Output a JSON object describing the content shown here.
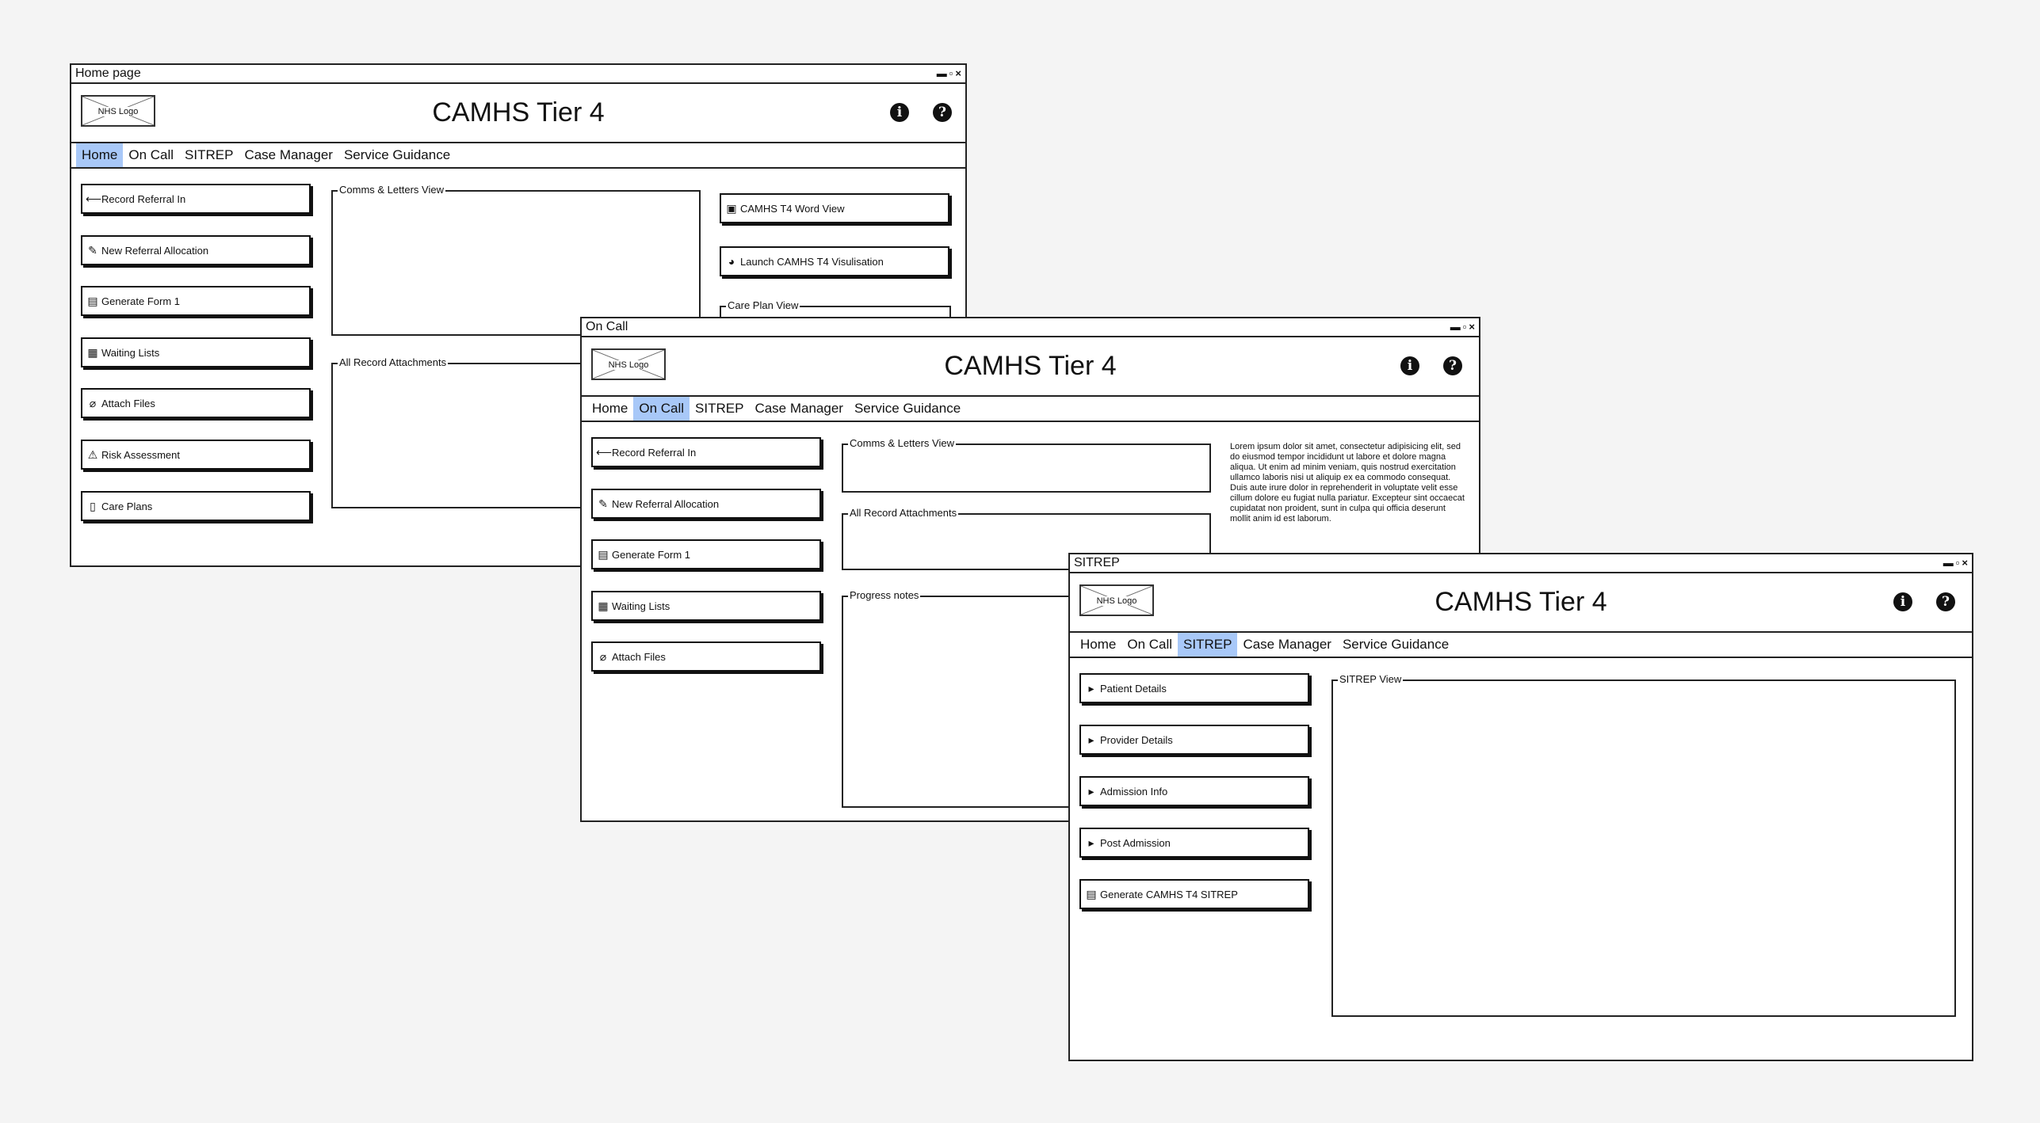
{
  "app_title": "CAMHS Tier 4",
  "logo_text": "NHS Logo",
  "window_controls": [
    "▬",
    "▫",
    "×"
  ],
  "header_icons": {
    "info": "i",
    "help": "?"
  },
  "nav": [
    "Home",
    "On Call",
    "SITREP",
    "Case Manager",
    "Service Guidance"
  ],
  "home": {
    "window_title": "Home page",
    "buttons": [
      "Record Referral In",
      "New Referral Allocation",
      "Generate Form 1",
      "Waiting Lists",
      "Attach Files",
      "Risk Assessment",
      "Care Plans"
    ],
    "panels": {
      "comms": "Comms & Letters View",
      "attachments": "All Record Attachments",
      "care_plan": "Care Plan View"
    },
    "right_buttons": [
      "CAMHS T4 Word View",
      "Launch CAMHS T4 Visulisation"
    ]
  },
  "oncall": {
    "window_title": "On Call",
    "buttons": [
      "Record Referral In",
      "New Referral Allocation",
      "Generate Form 1",
      "Waiting Lists",
      "Attach Files"
    ],
    "panels": {
      "comms": "Comms & Letters View",
      "attachments": "All Record Attachments",
      "progress": "Progress notes"
    },
    "lorem": "Lorem ipsum dolor sit amet, consectetur adipisicing elit, sed do eiusmod tempor incididunt ut labore et dolore magna aliqua. Ut enim ad minim veniam, quis nostrud exercitation ullamco laboris nisi ut aliquip ex ea commodo consequat. Duis aute irure dolor in reprehenderit in voluptate velit esse cillum dolore eu fugiat nulla pariatur. Excepteur sint occaecat cupidatat non proident, sunt in culpa qui officia deserunt mollit anim id est laborum."
  },
  "sitrep": {
    "window_title": "SITREP",
    "buttons": [
      "Patient Details",
      "Provider Details",
      "Admission Info",
      "Post Admission",
      "Generate CAMHS T4 SITREP"
    ],
    "panels": {
      "view": "SITREP View"
    }
  }
}
